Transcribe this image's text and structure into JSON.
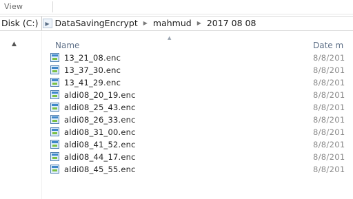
{
  "ribbon": {
    "tab_view": "View"
  },
  "address": {
    "drive": "Disk (C:)",
    "crumbs": [
      "DataSavingEncrypt",
      "mahmud",
      "2017 08 08"
    ]
  },
  "columns": {
    "name": "Name",
    "date": "Date m"
  },
  "files": [
    {
      "name": "13_21_08.enc",
      "date": "8/8/201"
    },
    {
      "name": "13_37_30.enc",
      "date": "8/8/201"
    },
    {
      "name": "13_41_29.enc",
      "date": "8/8/201"
    },
    {
      "name": "aldi08_20_19.enc",
      "date": "8/8/201"
    },
    {
      "name": "aldi08_25_43.enc",
      "date": "8/8/201"
    },
    {
      "name": "aldi08_26_33.enc",
      "date": "8/8/201"
    },
    {
      "name": "aldi08_31_00.enc",
      "date": "8/8/201"
    },
    {
      "name": "aldi08_41_52.enc",
      "date": "8/8/201"
    },
    {
      "name": "aldi08_44_17.enc",
      "date": "8/8/201"
    },
    {
      "name": "aldi08_45_55.enc",
      "date": "8/8/201"
    }
  ],
  "icons": {
    "expand_chevron": "chevron-right-icon",
    "nav_collapse": "chevron-up-icon",
    "sort_indicator": "sort-ascending-icon",
    "file": "encrypted-file-icon"
  }
}
